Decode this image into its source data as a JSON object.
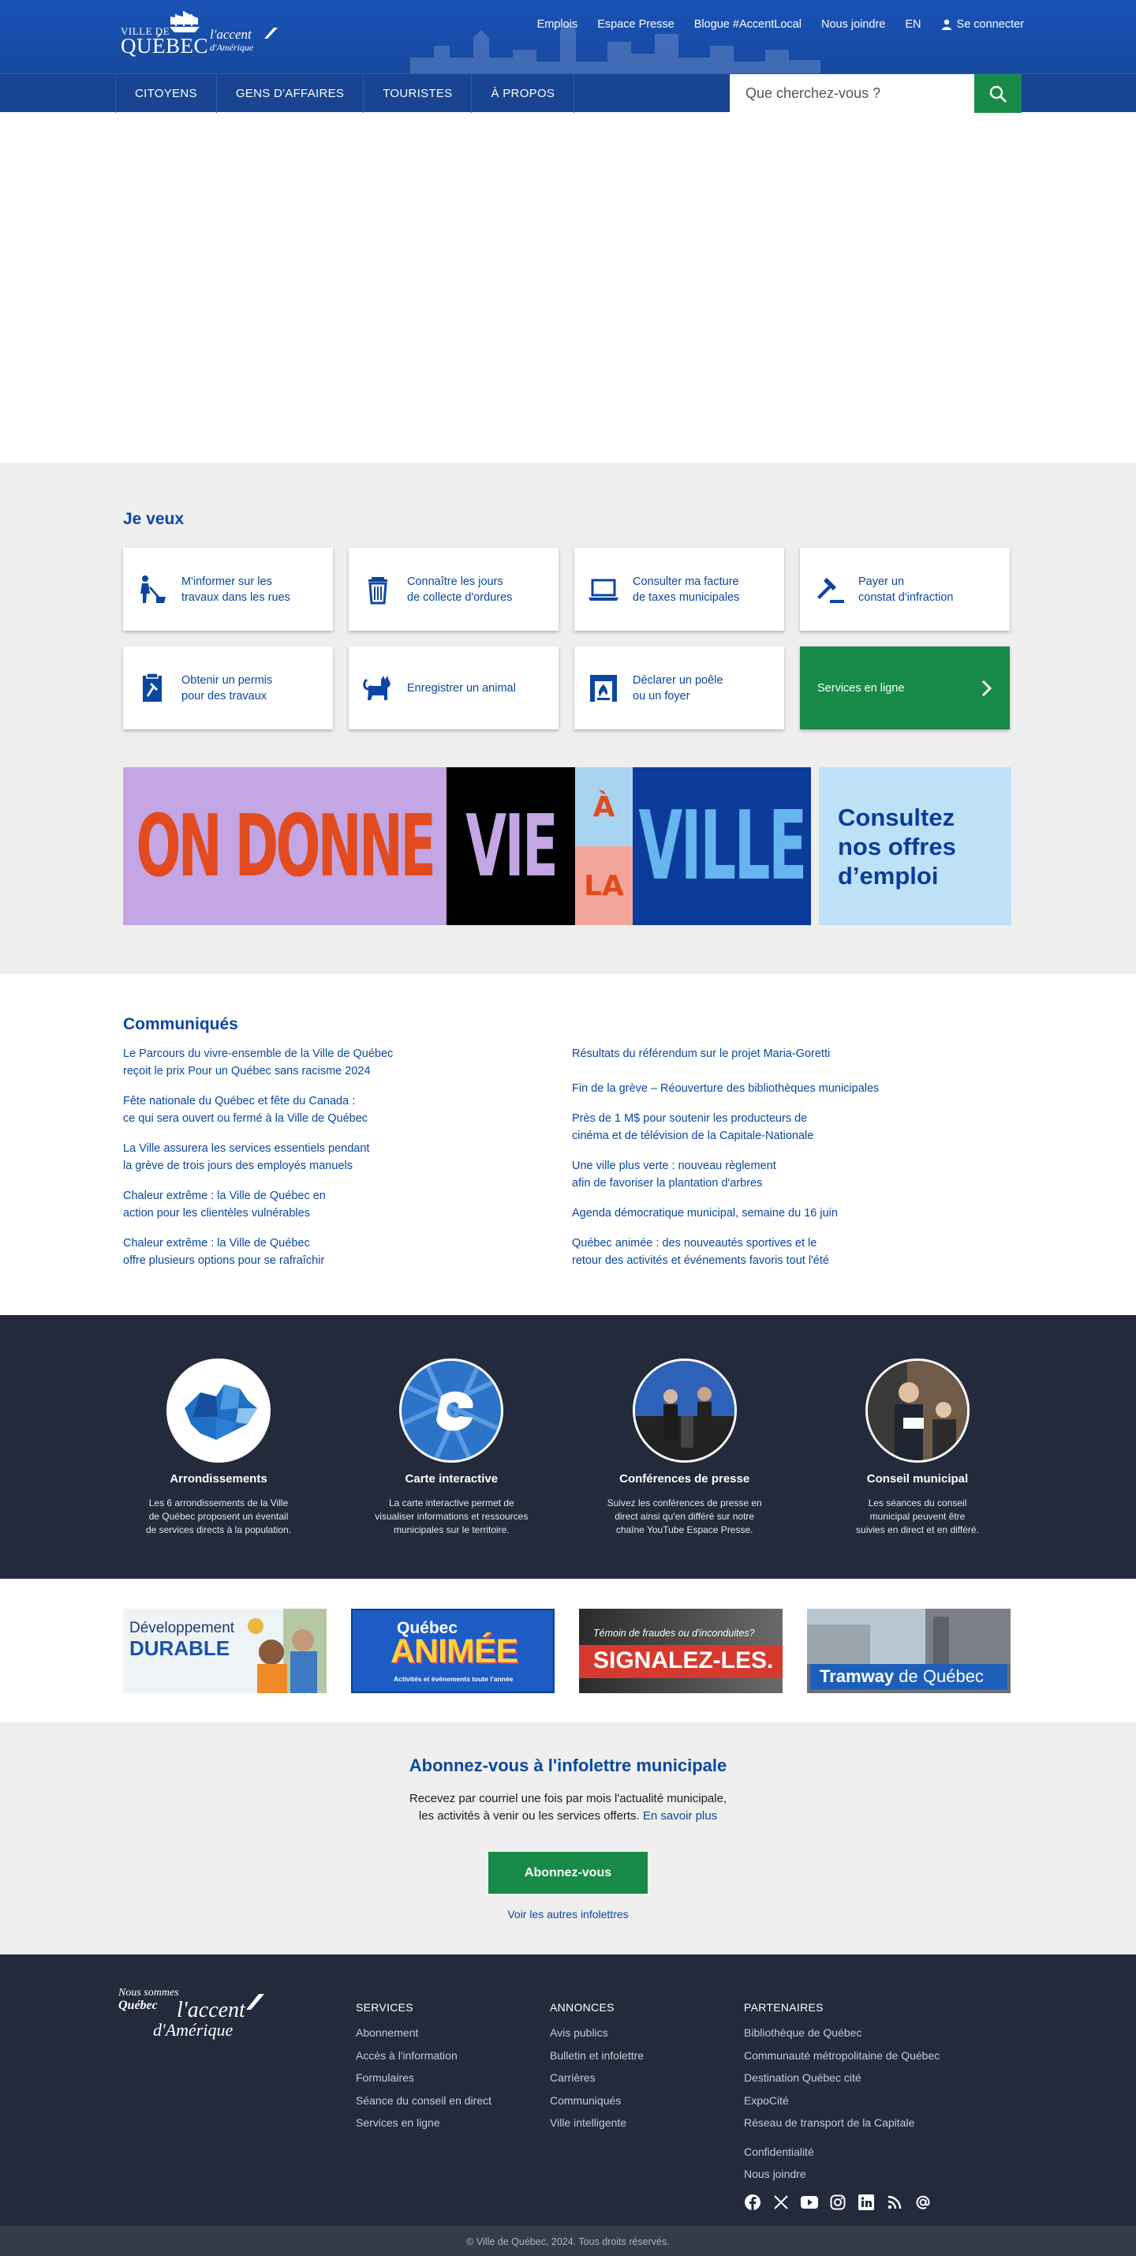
{
  "header": {
    "logo_ville_de": "VILLE DE",
    "logo_quebec": "QUÉBEC",
    "logo_accent": "l'accent",
    "logo_amerique": "d'Amérique",
    "top_links": [
      "Emplois",
      "Espace Presse",
      "Blogue #AccentLocal",
      "Nous joindre",
      "EN"
    ],
    "login_label": "Se connecter",
    "nav": [
      "CITOYENS",
      "GENS D'AFFAIRES",
      "TOURISTES",
      "À PROPOS"
    ],
    "search_placeholder": "Que cherchez-vous ?"
  },
  "je_veux": {
    "title": "Je veux",
    "cards": [
      {
        "label": "M'informer sur les\ntravaux dans les rues",
        "icon": "roadwork-icon"
      },
      {
        "label": "Connaître les jours\nde collecte d'ordures",
        "icon": "trash-icon"
      },
      {
        "label": "Consulter ma facture\nde taxes municipales",
        "icon": "laptop-icon"
      },
      {
        "label": "Payer un\nconstat d'infraction",
        "icon": "gavel-icon"
      },
      {
        "label": "Obtenir un permis\npour des travaux",
        "icon": "permit-icon"
      },
      {
        "label": "Enregistrer un animal",
        "icon": "cat-icon"
      },
      {
        "label": "Déclarer un poêle\nou un foyer",
        "icon": "fireplace-icon"
      },
      {
        "label": "Services en ligne",
        "icon": "chevron-right-icon"
      }
    ],
    "banner": {
      "part1": "ON DONNE",
      "part2": "VIE",
      "part3a": "À",
      "part3b": "LA",
      "part4": "VILLE",
      "cta": "Consultez\nnos offres\nd’emploi"
    }
  },
  "communiques": {
    "title": "Communiqués",
    "left": [
      "Le Parcours du vivre-ensemble de la Ville de Québec\nreçoit le prix Pour un Québec sans racisme 2024",
      "Fête nationale du Québec et fête du Canada :\nce qui sera ouvert ou fermé à la Ville de Québec",
      "La Ville assurera les services essentiels pendant\nla grève de trois jours des employés manuels",
      "Chaleur extrême : la Ville de Québec en\naction pour les clientèles vulnérables",
      "Chaleur extrême : la Ville de Québec\noffre plusieurs options pour se rafraîchir"
    ],
    "right": [
      "Résultats du référendum sur le projet Maria-Goretti",
      "Fin de la grève – Réouverture des bibliothèques municipales",
      "Près de 1 M$ pour soutenir les producteurs de\ncinéma et de télévision de la Capitale-Nationale",
      "Une ville plus verte : nouveau règlement\nafin de favoriser la plantation d'arbres",
      "Agenda démocratique municipal, semaine du 16 juin",
      "Québec animée : des nouveautés sportives et le\nretour des activités et événements favoris tout l'été"
    ]
  },
  "features": [
    {
      "title": "Arrondissements",
      "text": "Les 6 arrondissements de la Ville\nde Québec proposent un éventail\nde services directs à la population."
    },
    {
      "title": "Carte interactive",
      "text": "La carte interactive permet de\nvisualiser informations et ressources\nmunicipales sur le territoire."
    },
    {
      "title": "Conférences de presse",
      "text": "Suivez les conférences de presse en\ndirect ainsi qu'en différé sur notre\nchaîne YouTube Espace Presse."
    },
    {
      "title": "Conseil municipal",
      "text": "Les séances du conseil\nmunicipal peuvent être\nsuivies en direct et en différé."
    }
  ],
  "partners": {
    "dev_line1": "Développement",
    "dev_line2": "DURABLE",
    "anim_line1": "Québec",
    "anim_line2": "ANIMÉE",
    "anim_line3": "Activités et événements toute l'année",
    "fraude_line1": "Témoin de fraudes ou d'inconduites?",
    "fraude_line2": "SIGNALEZ-LES.",
    "tram_word1": "Tramway",
    "tram_word2": "de Québec"
  },
  "newsletter": {
    "title": "Abonnez-vous à l'infolettre municipale",
    "text": "Recevez par courriel une fois par mois l'actualité municipale,\nles activités à venir ou les services offerts.",
    "more_link": "En savoir plus",
    "button": "Abonnez-vous",
    "other_link": "Voir les autres infolettres"
  },
  "footer": {
    "logo_line1": "Nous sommes",
    "logo_line2": "Québec",
    "logo_accent": "l'accent",
    "logo_amerique": "d'Amérique",
    "services": {
      "title": "SERVICES",
      "links": [
        "Abonnement",
        "Accès à l'information",
        "Formulaires",
        "Séance du conseil en direct",
        "Services en ligne"
      ]
    },
    "annonces": {
      "title": "ANNONCES",
      "links": [
        "Avis publics",
        "Bulletin et infolettre",
        "Carrières",
        "Communiqués",
        "Ville intelligente"
      ]
    },
    "partenaires": {
      "title": "PARTENAIRES",
      "links": [
        "Bibliothèque de Québec",
        "Communauté métropolitaine de Québec",
        "Destination Québec cité",
        "ExpoCité",
        "Réseau de transport de la Capitale"
      ]
    },
    "extra_links": [
      "Confidentialité",
      "Nous joindre"
    ],
    "social_icons": [
      "facebook-icon",
      "x-icon",
      "youtube-icon",
      "instagram-icon",
      "linkedin-icon",
      "rss-icon",
      "email-icon"
    ],
    "copyright": "© Ville de Québec, 2024. Tous droits réservés."
  },
  "colors": {
    "brand_blue": "#1a52b6",
    "nav_blue": "#184491",
    "green": "#178a47",
    "dark": "#232a3b"
  }
}
